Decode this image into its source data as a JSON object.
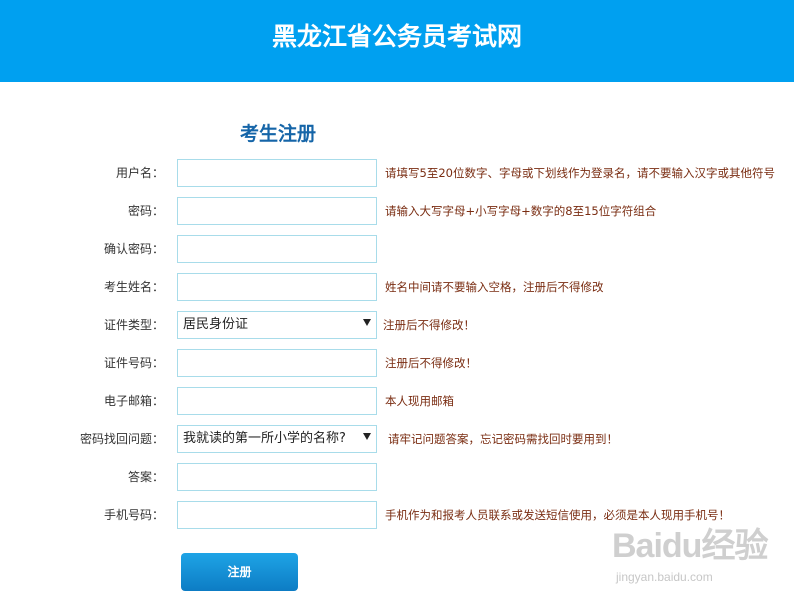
{
  "header": {
    "site_title": "黑龙江省公务员考试网"
  },
  "form": {
    "title": "考生注册",
    "fields": [
      {
        "label": "用户名：",
        "type": "text",
        "value": "",
        "hint": "请填写5至20位数字、字母或下划线作为登录名，请不要输入汉字或其他符号"
      },
      {
        "label": "密码：",
        "type": "password",
        "value": "",
        "hint": "请输入大写字母+小写字母+数字的8至15位字符组合"
      },
      {
        "label": "确认密码：",
        "type": "password",
        "value": "",
        "hint": ""
      },
      {
        "label": "考生姓名：",
        "type": "text",
        "value": "",
        "hint": "姓名中间请不要输入空格，注册后不得修改"
      },
      {
        "label": "证件类型：",
        "type": "select",
        "value": "居民身份证",
        "hint": "注册后不得修改！"
      },
      {
        "label": "证件号码：",
        "type": "text",
        "value": "",
        "hint": "注册后不得修改！"
      },
      {
        "label": "电子邮箱：",
        "type": "text",
        "value": "",
        "hint": "本人现用邮箱"
      },
      {
        "label": "密码找回问题：",
        "type": "select",
        "value": "我就读的第一所小学的名称?",
        "hint": "请牢记问题答案，忘记密码需找回时要用到！"
      },
      {
        "label": "答案：",
        "type": "text",
        "value": "",
        "hint": ""
      },
      {
        "label": "手机号码：",
        "type": "text",
        "value": "",
        "hint": "手机作为和报考人员联系或发送短信使用，必须是本人现用手机号！"
      }
    ],
    "submit_label": "注册"
  },
  "watermark": {
    "logo": "Baidu经验",
    "url": "jingyan.baidu.com"
  },
  "colors": {
    "header_bg": "#00a0f0",
    "title_blue": "#1565a8",
    "hint_text": "#7a2d12",
    "input_border": "#a8dcea",
    "button_bg": "#0d7cc4"
  }
}
